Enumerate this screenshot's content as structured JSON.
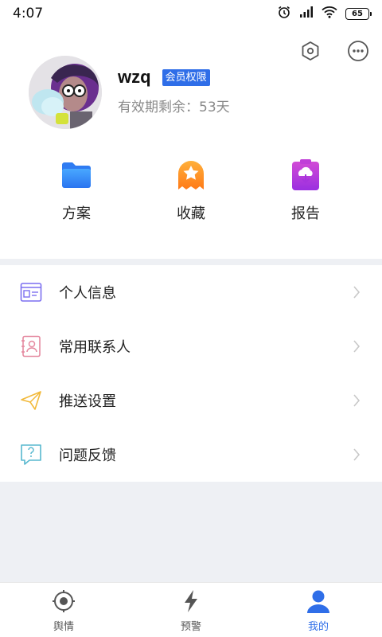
{
  "status_bar": {
    "time": "4:07",
    "battery": "65"
  },
  "profile": {
    "username": "wzq",
    "member_badge": "会员权限",
    "validity": "有效期剩余：53天"
  },
  "quick_actions": [
    {
      "label": "方案",
      "icon": "folder-icon"
    },
    {
      "label": "收藏",
      "icon": "star-bookmark-icon"
    },
    {
      "label": "报告",
      "icon": "cloud-download-report-icon"
    }
  ],
  "menu": [
    {
      "label": "个人信息",
      "icon": "id-card-icon"
    },
    {
      "label": "常用联系人",
      "icon": "contact-book-icon"
    },
    {
      "label": "推送设置",
      "icon": "paper-plane-icon"
    },
    {
      "label": "问题反馈",
      "icon": "question-chat-icon"
    }
  ],
  "bottom_nav": [
    {
      "label": "舆情",
      "icon": "target-icon",
      "active": false
    },
    {
      "label": "预警",
      "icon": "lightning-icon",
      "active": false
    },
    {
      "label": "我的",
      "icon": "user-icon",
      "active": true
    }
  ],
  "colors": {
    "accent": "#2f6ee8",
    "band": "#eef0f4",
    "muted_text": "#8a8a8a"
  }
}
